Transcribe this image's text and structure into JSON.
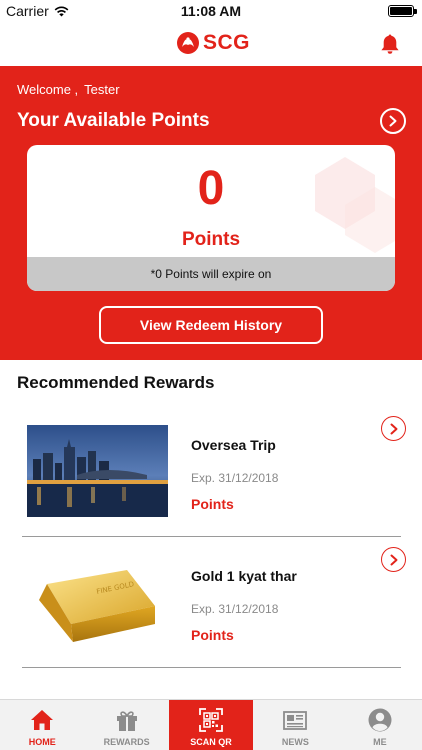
{
  "status_bar": {
    "carrier": "Carrier",
    "time": "11:08 AM"
  },
  "header": {
    "logo_text": "SCG"
  },
  "hero": {
    "welcome_prefix": "Welcome ,",
    "user_name": "Tester",
    "title": "Your Available Points",
    "points_value": "0",
    "points_label": "Points",
    "expire_note": "*0 Points will expire on",
    "redeem_button": "View Redeem History"
  },
  "recommended": {
    "title": "Recommended Rewards",
    "items": [
      {
        "name": "Oversea Trip",
        "expiry": "Exp. 31/12/2018",
        "points_label": "Points",
        "image": "city-skyline-night"
      },
      {
        "name": "Gold 1 kyat thar",
        "expiry": "Exp. 31/12/2018",
        "points_label": "Points",
        "image": "gold-bar"
      }
    ]
  },
  "tabs": [
    {
      "label": "HOME",
      "icon": "home-icon",
      "state": "active"
    },
    {
      "label": "REWARDS",
      "icon": "gift-icon",
      "state": "normal"
    },
    {
      "label": "SCAN QR",
      "icon": "qr-icon",
      "state": "highlight"
    },
    {
      "label": "NEWS",
      "icon": "newspaper-icon",
      "state": "normal"
    },
    {
      "label": "ME",
      "icon": "user-icon",
      "state": "normal"
    }
  ],
  "colors": {
    "brand_red": "#e2231a",
    "tab_inactive": "#8c8c8c",
    "expiry_gray": "#8a8a8a"
  }
}
